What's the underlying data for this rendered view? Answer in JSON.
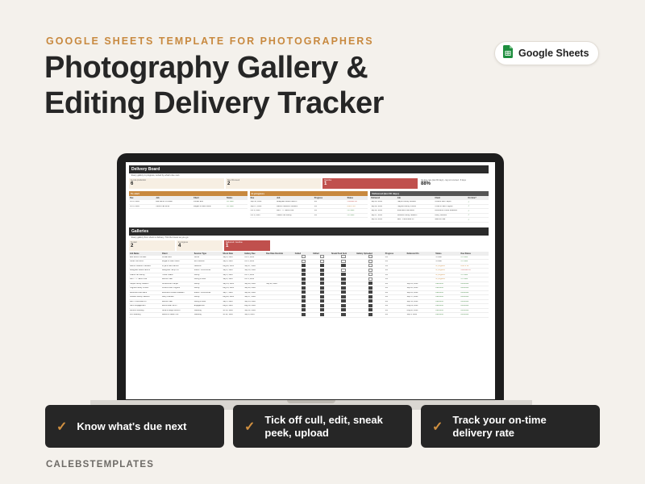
{
  "eyebrow": "GOOGLE SHEETS TEMPLATE FOR PHOTOGRAPHERS",
  "title_line1": "Photography Gallery &",
  "title_line2": "Editing Delivery Tracker",
  "badge": {
    "label": "Google Sheets",
    "icon": "google-sheets-icon",
    "color": "#1e8e3e"
  },
  "colors": {
    "background": "#f4f1ec",
    "accent": "#c8893f",
    "danger": "#c0504d",
    "dark": "#262626"
  },
  "sheet": {
    "board_title": "Delivery Board",
    "board_sub": "Every gallery in progress, sorted by what's due next.",
    "kpis": [
      {
        "label": "In post-production",
        "value": "6",
        "style": "cream"
      },
      {
        "label": "Due this week",
        "value": "2",
        "style": "cream"
      },
      {
        "label": "Overdue",
        "value": "1",
        "style": "red"
      },
      {
        "label": "On-time rate (last 90 days) - lag not counted - 8 days",
        "value": "88%",
        "style": "plain"
      }
    ],
    "panels": [
      {
        "title": "To start",
        "style": "orange",
        "cols": [
          "Due",
          "Job",
          "Client",
          "Status"
        ],
        "rows": [
          [
            "Oct 8, 2026",
            "Ella Senior Portraits",
            "Jordan Ellis",
            "On track"
          ],
          [
            "Oct 6, 2026",
            "Carter Fall Minis",
            "Megan & Luke Carter",
            "On track"
          ]
        ]
      },
      {
        "title": "In progress",
        "style": "orange",
        "cols": [
          "Due",
          "Job",
          "Progress",
          "Status"
        ],
        "rows": [
          [
            "Sep 18, 2026",
            "Bluegrass Brand Launch",
            "2/4",
            "Overdue 4d"
          ],
          [
            "Sep 27, 2026",
            "Ramon Newborn Session",
            "3/4",
            "Due in 2d"
          ],
          [
            "Oct 4, 2026",
            "Iden - 77 Harbor Ave",
            "3/4",
            "On track"
          ],
          [
            "Oct 3, 2026",
            "Okafor Fall Family",
            "3/4",
            "On track"
          ]
        ]
      },
      {
        "title": "Delivered (last 30 days)",
        "style": "dark",
        "cols": [
          "Delivered",
          "Job",
          "Client",
          "On time?"
        ],
        "rows": [
          [
            "Sep 24, 2026",
            "Harper Family Session",
            "Olivia & Ben Harper",
            "✓"
          ],
          [
            "Sep 20, 2026",
            "Hughes Family Photos",
            "Chloe & Sam Hughes",
            "✓"
          ],
          [
            "Sep 22, 2026",
            "Riverbend Fall Menu",
            "Riverbend Coffee Roasters",
            "✓"
          ],
          [
            "Sep 17, 2026",
            "Graham Family Session",
            "Avery Graham",
            "✓"
          ],
          [
            "Sep 14, 2026",
            "Iden - 8 Elmrisde Ln",
            "Marcus Hale",
            "✓"
          ]
        ]
      }
    ],
    "galleries_title": "Galleries",
    "galleries_sub": "Every gallery from shoot to delivery. Tick the boxes as you go.",
    "gallery_kpis": [
      {
        "label": "To start",
        "value": "2",
        "style": "cream"
      },
      {
        "label": "In progress",
        "value": "4",
        "style": "cream"
      },
      {
        "label": "Delivered / overdue",
        "value": "1",
        "style": "red"
      }
    ],
    "gallery_cols": [
      "Job Name",
      "Client",
      "Session Type",
      "Shoot Date",
      "Gallery Due",
      "Due Date Override",
      "Culled",
      "Edited",
      "Sneak Peek Sent",
      "Gallery Uploaded",
      "Progress",
      "Delivered On",
      "Status",
      "Due Status"
    ],
    "gallery_rows": [
      [
        "Ella Senior Portraits",
        "Jordan Ellis",
        "Senior",
        "Sep 8, 2026",
        "Oct 8, 2026",
        "",
        "0",
        "0",
        "0",
        "0",
        "0/4",
        "",
        "To start",
        "On track"
      ],
      [
        "Carter Fall Minis",
        "Megan & Luke Carter",
        "Mini Session",
        "Sep 6, 2026",
        "Oct 6, 2026",
        "",
        "0",
        "0",
        "0",
        "0",
        "0/4",
        "",
        "To start",
        "On track"
      ],
      [
        "Ramon Newborn Session",
        "Priya & Sam Ramon",
        "Newborn",
        "Aug 28, 2026",
        "Sep 27, 2026",
        "",
        "1",
        "1",
        "1",
        "0",
        "3/4",
        "",
        "In progress",
        "Due in 2d"
      ],
      [
        "Bluegrass Brand Launch",
        "Bluegrass Hemp Co.",
        "Brand / Commercial",
        "Sep 4, 2026",
        "Sep 18, 2026",
        "",
        "1",
        "1",
        "0",
        "0",
        "2/4",
        "",
        "In progress",
        "Overdue 4d"
      ],
      [
        "Okafor Fall Family",
        "Tunde Okafor",
        "Family",
        "Sep 3, 2026",
        "Oct 3, 2026",
        "",
        "1",
        "1",
        "1",
        "0",
        "3/4",
        "",
        "In progress",
        "On track"
      ],
      [
        "Iden - 77 Harbor Ave",
        "Marcus Hale",
        "Listing Photos",
        "Sep 4, 2026",
        "Oct 4, 2026",
        "",
        "1",
        "1",
        "1",
        "0",
        "3/4",
        "",
        "In progress",
        "On track"
      ],
      [
        "Harper Family Session",
        "Olivia & Ben Harper",
        "Family",
        "Sep 14, 2026",
        "Sep 28, 2026",
        "Sep 26, 2026",
        "1",
        "1",
        "1",
        "1",
        "4/4",
        "Sep 24, 2026",
        "Delivered",
        "Delivered"
      ],
      [
        "Hughes Family Photos",
        "Chloe & Sam Hughes",
        "Family",
        "Aug 31, 2026",
        "Sep 20, 2026",
        "",
        "1",
        "1",
        "1",
        "1",
        "4/4",
        "Sep 20, 2026",
        "Delivered",
        "Delivered"
      ],
      [
        "Riverbend Fall Menu",
        "Riverbend Coffee Roasters",
        "Brand / Commercial",
        "Sep 7, 2026",
        "Sep 22, 2026",
        "",
        "1",
        "1",
        "1",
        "1",
        "4/4",
        "Sep 22, 2026",
        "Delivered",
        "Delivered"
      ],
      [
        "Graham Family Session",
        "Avery Graham",
        "Family",
        "Aug 28, 2026",
        "Sep 17, 2026",
        "",
        "1",
        "1",
        "1",
        "1",
        "4/4",
        "Sep 17, 2026",
        "Delivered",
        "Delivered"
      ],
      [
        "Iden - 8 Elmrisde Ln",
        "Marcus Hale",
        "Listing Photos",
        "Sep 5, 2026",
        "Sep 14, 2026",
        "",
        "1",
        "1",
        "1",
        "1",
        "4/4",
        "Sep 14, 2026",
        "Delivered",
        "Delivered"
      ],
      [
        "Stirch Engagement",
        "Mia & Noah Stirch",
        "Engagement",
        "Aug 9, 2026",
        "Aug 30, 2026",
        "",
        "1",
        "1",
        "1",
        "1",
        "4/4",
        "Aug 29, 2026",
        "Delivered",
        "Delivered"
      ],
      [
        "Moreno Wedding",
        "Sofia & Diego Moreno",
        "Wedding",
        "Jul 18, 2026",
        "Sep 12, 2026",
        "",
        "1",
        "1",
        "1",
        "1",
        "4/4",
        "Aug 28, 2026",
        "Delivered",
        "Delivered"
      ],
      [
        "Fox Wedding",
        "Lauren & Jason Fox",
        "Wedding",
        "Jul 12, 2026",
        "Sep 6, 2026",
        "",
        "1",
        "1",
        "1",
        "1",
        "4/4",
        "Sep 9, 2026",
        "Delivered",
        "Delivered"
      ]
    ]
  },
  "features": [
    {
      "text": "Know what's due next",
      "icon": "check-icon"
    },
    {
      "text": "Tick off cull, edit, sneak peek, upload",
      "icon": "check-icon"
    },
    {
      "text": "Track your on-time delivery rate",
      "icon": "check-icon"
    }
  ],
  "footer": "CALEBSTEMPLATES"
}
